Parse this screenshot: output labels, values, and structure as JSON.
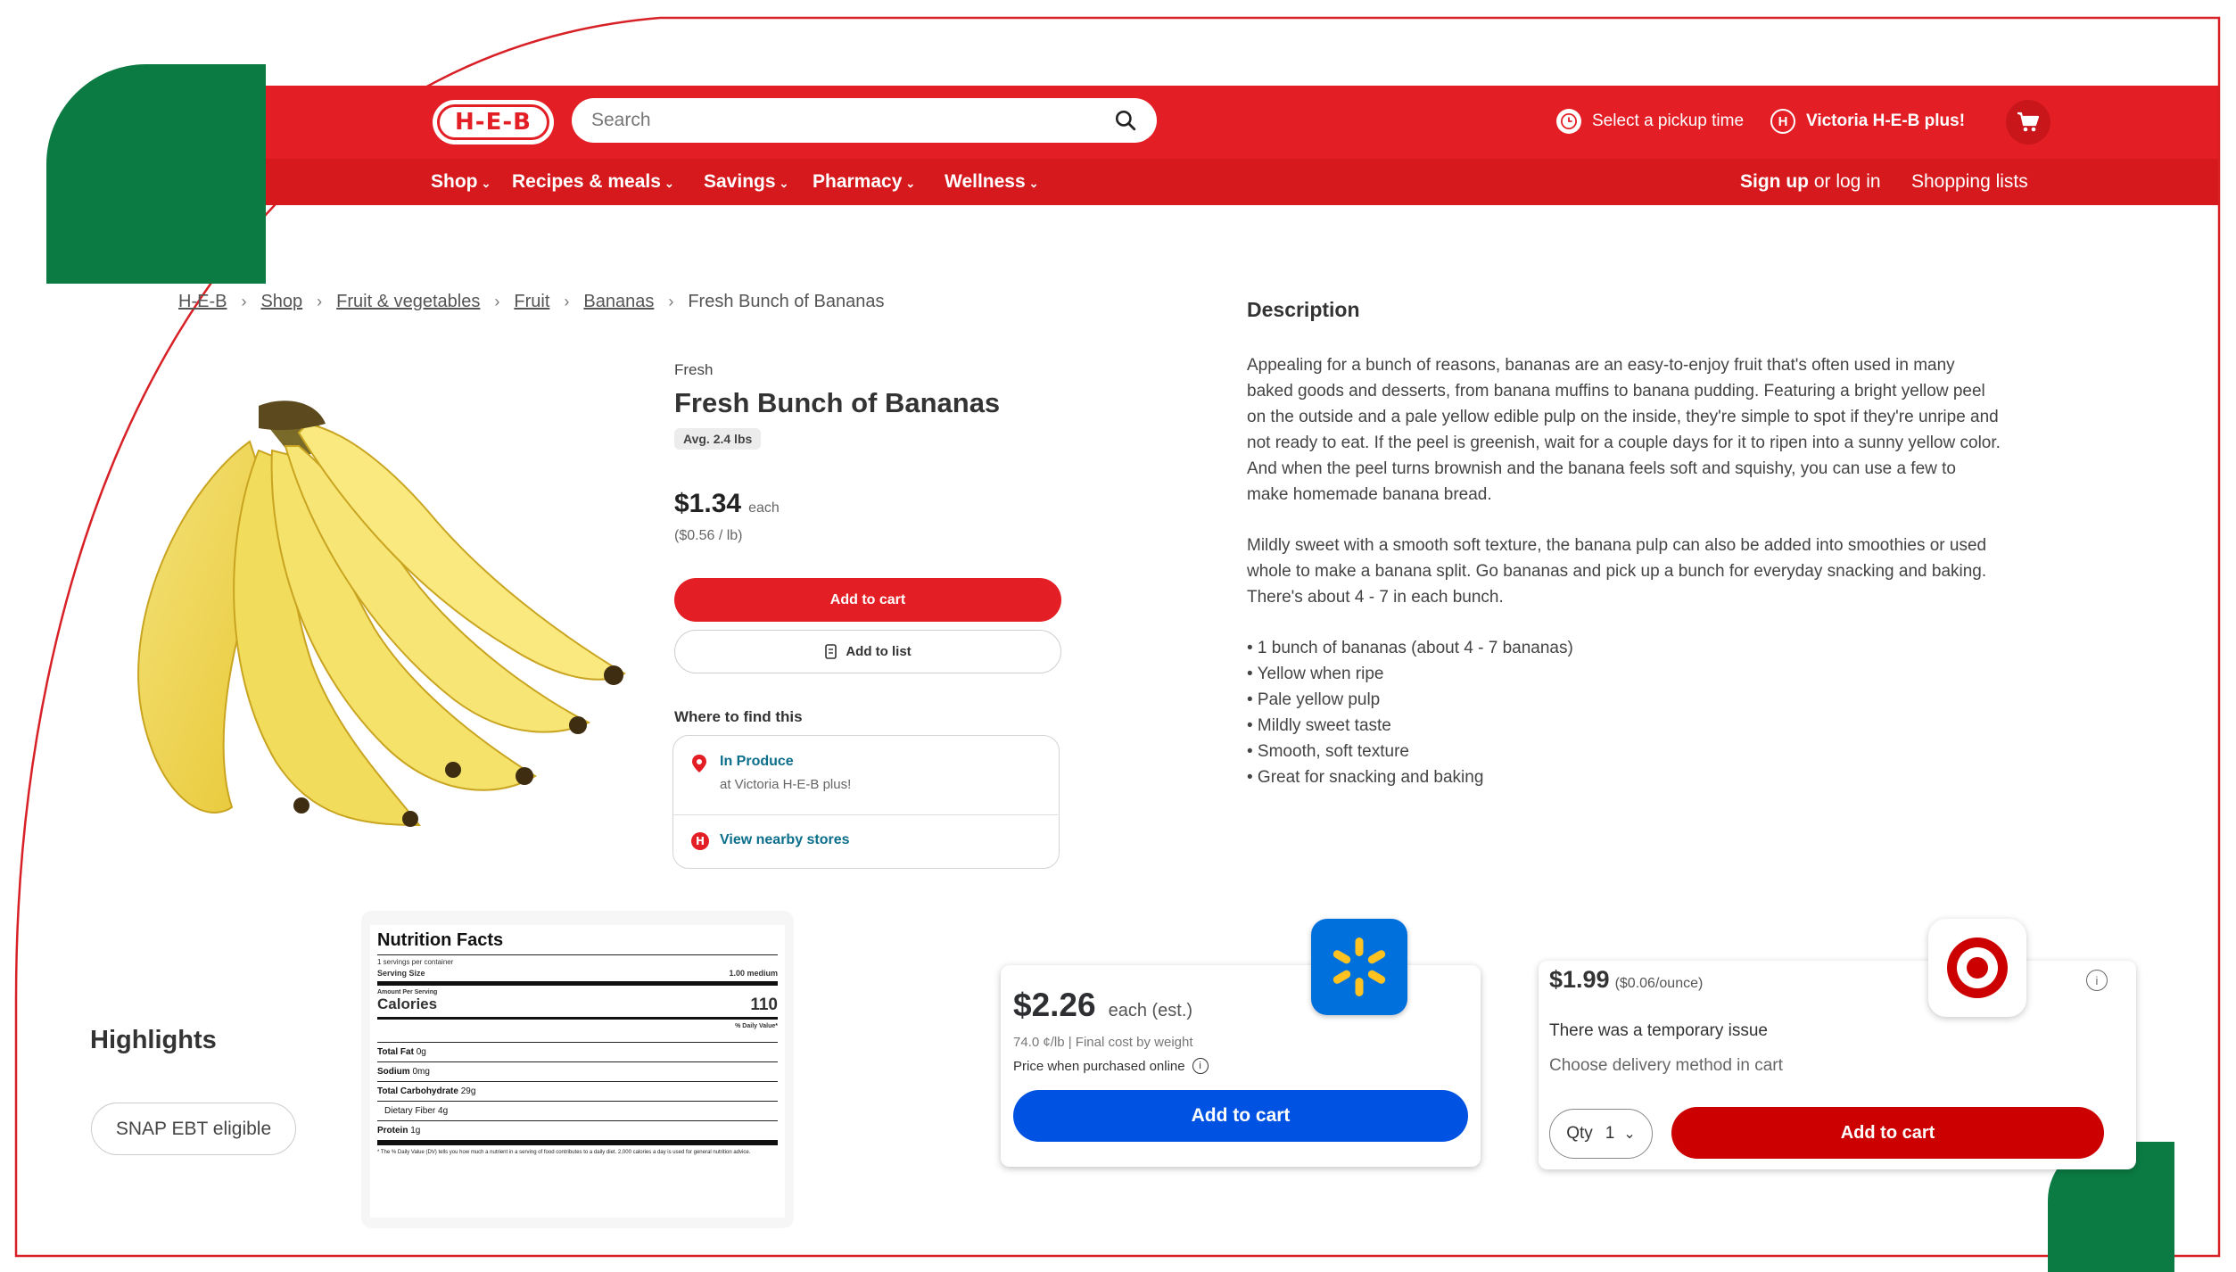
{
  "header": {
    "logo_text": "H-E-B",
    "search_placeholder": "Search",
    "pickup_label": "Select a pickup time",
    "store_label": "Victoria H-E-B plus!"
  },
  "nav": {
    "items": [
      "Shop",
      "Recipes & meals",
      "Savings",
      "Pharmacy",
      "Wellness"
    ],
    "sign_up": "Sign up",
    "or_log_in": " or log in",
    "shopping_lists": "Shopping lists"
  },
  "breadcrumb": [
    "H-E-B",
    "Shop",
    "Fruit & vegetables",
    "Fruit",
    "Bananas",
    "Fresh Bunch of Bananas"
  ],
  "product": {
    "brand": "Fresh",
    "name": "Fresh Bunch of Bananas",
    "weight_badge": "Avg. 2.4 lbs",
    "price": "$1.34",
    "price_unit": "each",
    "unit_price": "($0.56 / lb)",
    "add_to_cart": "Add to cart",
    "add_to_list": "Add to list",
    "where_title": "Where to find this",
    "location_title": "In Produce",
    "location_sub": "at Victoria H-E-B plus!",
    "nearby": "View nearby stores"
  },
  "description": {
    "title": "Description",
    "para1": "Appealing for a bunch of reasons, bananas are an easy-to-enjoy fruit that's often used in many baked goods and desserts, from banana muffins to banana pudding. Featuring a bright yellow peel on the outside and a pale yellow edible pulp on the inside, they're simple to spot if they're unripe and not ready to eat. If the peel is greenish, wait for a couple days for it to ripen into a sunny yellow color. And when the peel turns brownish and the banana feels soft and squishy, you can use a few to make homemade banana bread.",
    "para2": "Mildly sweet with a smooth soft texture, the banana pulp can also be added into smoothies or used whole to make a banana split. Go bananas and pick up a bunch for everyday snacking and baking. There's about 4 - 7 in each bunch.",
    "bullets": [
      "• 1 bunch of bananas (about 4 - 7 bananas)",
      "• Yellow when ripe",
      "• Pale yellow pulp",
      "• Mildly sweet taste",
      "• Smooth, soft texture",
      "• Great for snacking and baking"
    ]
  },
  "highlights": {
    "title": "Highlights",
    "chip": "SNAP EBT eligible"
  },
  "nutrition": {
    "title": "Nutrition Facts",
    "servings": "1 servings per container",
    "serving_size_label": "Serving Size",
    "serving_size_value": "1.00 medium",
    "amount_per": "Amount Per Serving",
    "calories_label": "Calories",
    "calories_value": "110",
    "dv_header": "% Daily Value*",
    "fat_label": "Total Fat",
    "fat_value": "0g",
    "sodium_label": "Sodium",
    "sodium_value": "0mg",
    "carb_label": "Total Carbohydrate",
    "carb_value": "29g",
    "fiber_label": "Dietary Fiber",
    "fiber_value": "4g",
    "protein_label": "Protein",
    "protein_value": "1g",
    "footnote": "* The % Daily Value (DV) tells you how much a nutrient in a serving of food contributes to a daily diet. 2,000 calories a day is used for general nutrition advice."
  },
  "walmart": {
    "price": "$2.26",
    "price_unit": "each (est.)",
    "unit_price": "74.0 ¢/lb | Final cost by weight",
    "online_note": "Price when purchased online",
    "add_to_cart": "Add to cart"
  },
  "target": {
    "price": "$1.99",
    "unit_price": "($0.06/ounce)",
    "issue": "There was a temporary issue",
    "delivery": "Choose delivery method in cart",
    "qty_label": "Qty",
    "qty_value": "1",
    "add_to_cart": "Add to cart"
  },
  "colors": {
    "heb_red": "#e31f25",
    "green": "#0b7b43",
    "walmart_blue": "#0053e2",
    "walmart_yellow": "#ffc220",
    "target_red": "#cc0000",
    "link_teal": "#0b6e8a"
  }
}
